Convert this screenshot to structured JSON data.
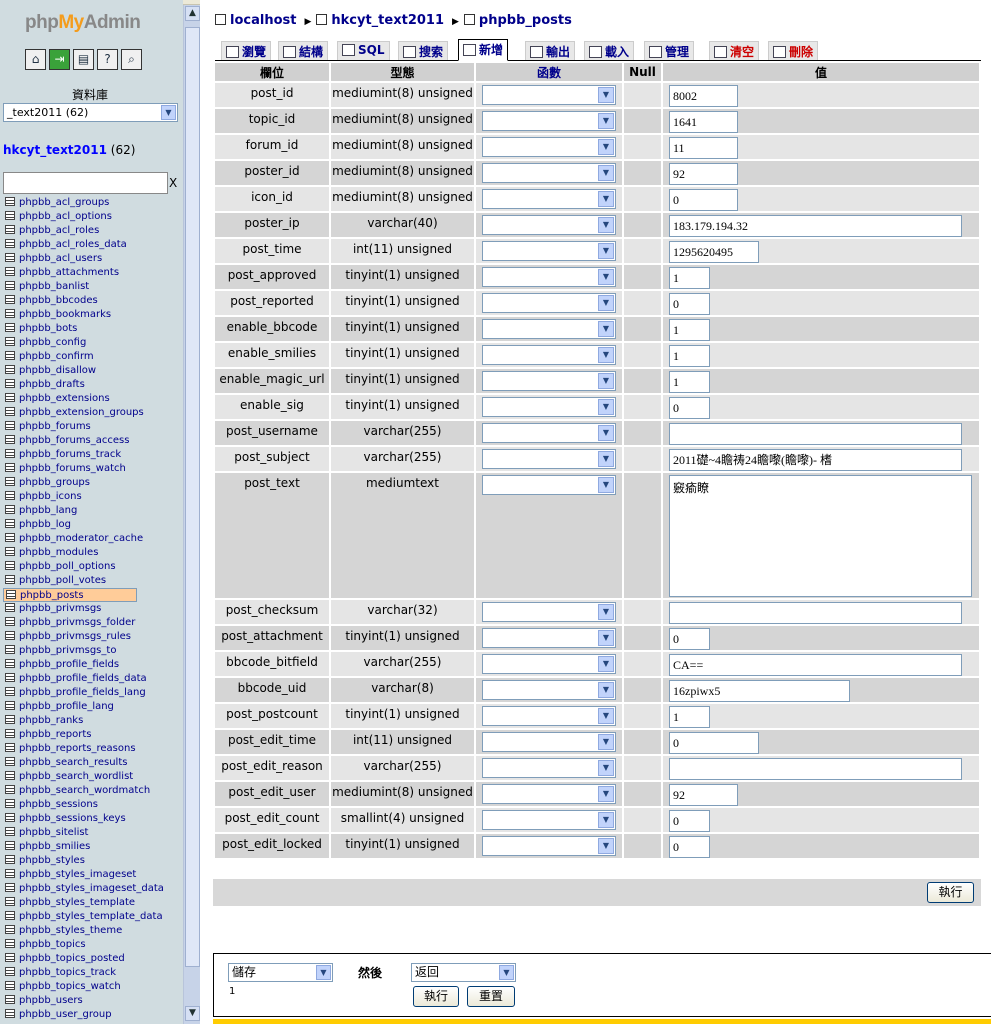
{
  "left_frame": {
    "logo_php": "php",
    "logo_my": "My",
    "logo_admin": "Admin",
    "icons": [
      "home-icon",
      "exit-icon",
      "sql-icon",
      "docs-icon",
      "help-icon"
    ],
    "db_label": "資料庫",
    "db_select_value": "_text2011 (62)",
    "db_title": "hkcyt_text2011",
    "db_count": "(62)",
    "filter_clear": "X",
    "tables": [
      "phpbb_acl_groups",
      "phpbb_acl_options",
      "phpbb_acl_roles",
      "phpbb_acl_roles_data",
      "phpbb_acl_users",
      "phpbb_attachments",
      "phpbb_banlist",
      "phpbb_bbcodes",
      "phpbb_bookmarks",
      "phpbb_bots",
      "phpbb_config",
      "phpbb_confirm",
      "phpbb_disallow",
      "phpbb_drafts",
      "phpbb_extensions",
      "phpbb_extension_groups",
      "phpbb_forums",
      "phpbb_forums_access",
      "phpbb_forums_track",
      "phpbb_forums_watch",
      "phpbb_groups",
      "phpbb_icons",
      "phpbb_lang",
      "phpbb_log",
      "phpbb_moderator_cache",
      "phpbb_modules",
      "phpbb_poll_options",
      "phpbb_poll_votes",
      "phpbb_posts",
      "phpbb_privmsgs",
      "phpbb_privmsgs_folder",
      "phpbb_privmsgs_rules",
      "phpbb_privmsgs_to",
      "phpbb_profile_fields",
      "phpbb_profile_fields_data",
      "phpbb_profile_fields_lang",
      "phpbb_profile_lang",
      "phpbb_ranks",
      "phpbb_reports",
      "phpbb_reports_reasons",
      "phpbb_search_results",
      "phpbb_search_wordlist",
      "phpbb_search_wordmatch",
      "phpbb_sessions",
      "phpbb_sessions_keys",
      "phpbb_sitelist",
      "phpbb_smilies",
      "phpbb_styles",
      "phpbb_styles_imageset",
      "phpbb_styles_imageset_data",
      "phpbb_styles_template",
      "phpbb_styles_template_data",
      "phpbb_styles_theme",
      "phpbb_topics",
      "phpbb_topics_posted",
      "phpbb_topics_track",
      "phpbb_topics_watch",
      "phpbb_users",
      "phpbb_user_group"
    ],
    "selected_table": "phpbb_posts"
  },
  "breadcrumb": {
    "server": "localhost",
    "database": "hkcyt_text2011",
    "table": "phpbb_posts"
  },
  "tabs": [
    {
      "label": "瀏覽",
      "icon": "browse-icon"
    },
    {
      "label": "結構",
      "icon": "structure-icon"
    },
    {
      "label": "SQL",
      "icon": "sql-icon"
    },
    {
      "label": "搜索",
      "icon": "search-icon"
    },
    {
      "label": "新增",
      "icon": "insert-icon"
    },
    {
      "label": "輸出",
      "icon": "export-icon"
    },
    {
      "label": "載入",
      "icon": "import-icon"
    },
    {
      "label": "管理",
      "icon": "operations-icon"
    },
    {
      "label": "清空",
      "icon": "empty-icon"
    },
    {
      "label": "刪除",
      "icon": "drop-icon"
    }
  ],
  "active_tab": "新增",
  "grid": {
    "headers": {
      "field": "欄位",
      "type": "型態",
      "function": "函數",
      "null": "Null",
      "value": "值"
    },
    "rows": [
      {
        "field": "post_id",
        "type": "mediumint(8) unsigned",
        "value": "8002",
        "w": "s"
      },
      {
        "field": "topic_id",
        "type": "mediumint(8) unsigned",
        "value": "1641",
        "w": "s"
      },
      {
        "field": "forum_id",
        "type": "mediumint(8) unsigned",
        "value": "11",
        "w": "s"
      },
      {
        "field": "poster_id",
        "type": "mediumint(8) unsigned",
        "value": "92",
        "w": "s"
      },
      {
        "field": "icon_id",
        "type": "mediumint(8) unsigned",
        "value": "0",
        "w": "s"
      },
      {
        "field": "poster_ip",
        "type": "varchar(40)",
        "value": "183.179.194.32",
        "w": "l"
      },
      {
        "field": "post_time",
        "type": "int(11) unsigned",
        "value": "1295620495",
        "w": "m"
      },
      {
        "field": "post_approved",
        "type": "tinyint(1) unsigned",
        "value": "1",
        "w": "xs"
      },
      {
        "field": "post_reported",
        "type": "tinyint(1) unsigned",
        "value": "0",
        "w": "xs"
      },
      {
        "field": "enable_bbcode",
        "type": "tinyint(1) unsigned",
        "value": "1",
        "w": "xs"
      },
      {
        "field": "enable_smilies",
        "type": "tinyint(1) unsigned",
        "value": "1",
        "w": "xs"
      },
      {
        "field": "enable_magic_url",
        "type": "tinyint(1) unsigned",
        "value": "1",
        "w": "xs"
      },
      {
        "field": "enable_sig",
        "type": "tinyint(1) unsigned",
        "value": "0",
        "w": "xs"
      },
      {
        "field": "post_username",
        "type": "varchar(255)",
        "value": "",
        "w": "l"
      },
      {
        "field": "post_subject",
        "type": "varchar(255)",
        "value": "2011礎~4瞻祷24瞻嚟(瞻嚟)- 榰",
        "w": "l"
      },
      {
        "field": "post_text",
        "type": "mediumtext",
        "value": "竅瘉瞭",
        "w": "ta"
      },
      {
        "field": "post_checksum",
        "type": "varchar(32)",
        "value": "",
        "w": "l"
      },
      {
        "field": "post_attachment",
        "type": "tinyint(1) unsigned",
        "value": "0",
        "w": "xs"
      },
      {
        "field": "bbcode_bitfield",
        "type": "varchar(255)",
        "value": "CA==",
        "w": "l"
      },
      {
        "field": "bbcode_uid",
        "type": "varchar(8)",
        "value": "16zpiwx5",
        "w": "ml"
      },
      {
        "field": "post_postcount",
        "type": "tinyint(1) unsigned",
        "value": "1",
        "w": "xs"
      },
      {
        "field": "post_edit_time",
        "type": "int(11) unsigned",
        "value": "0",
        "w": "m"
      },
      {
        "field": "post_edit_reason",
        "type": "varchar(255)",
        "value": "",
        "w": "l"
      },
      {
        "field": "post_edit_user",
        "type": "mediumint(8) unsigned",
        "value": "92",
        "w": "s"
      },
      {
        "field": "post_edit_count",
        "type": "smallint(4) unsigned",
        "value": "0",
        "w": "xs"
      },
      {
        "field": "post_edit_locked",
        "type": "tinyint(1) unsigned",
        "value": "0",
        "w": "xs"
      }
    ]
  },
  "go_button": "執行",
  "bottom": {
    "action_select": "儲存",
    "then_label": "然後",
    "after_select": "返回",
    "count_text": "1",
    "go_button": "執行",
    "reset_button": "重置"
  }
}
